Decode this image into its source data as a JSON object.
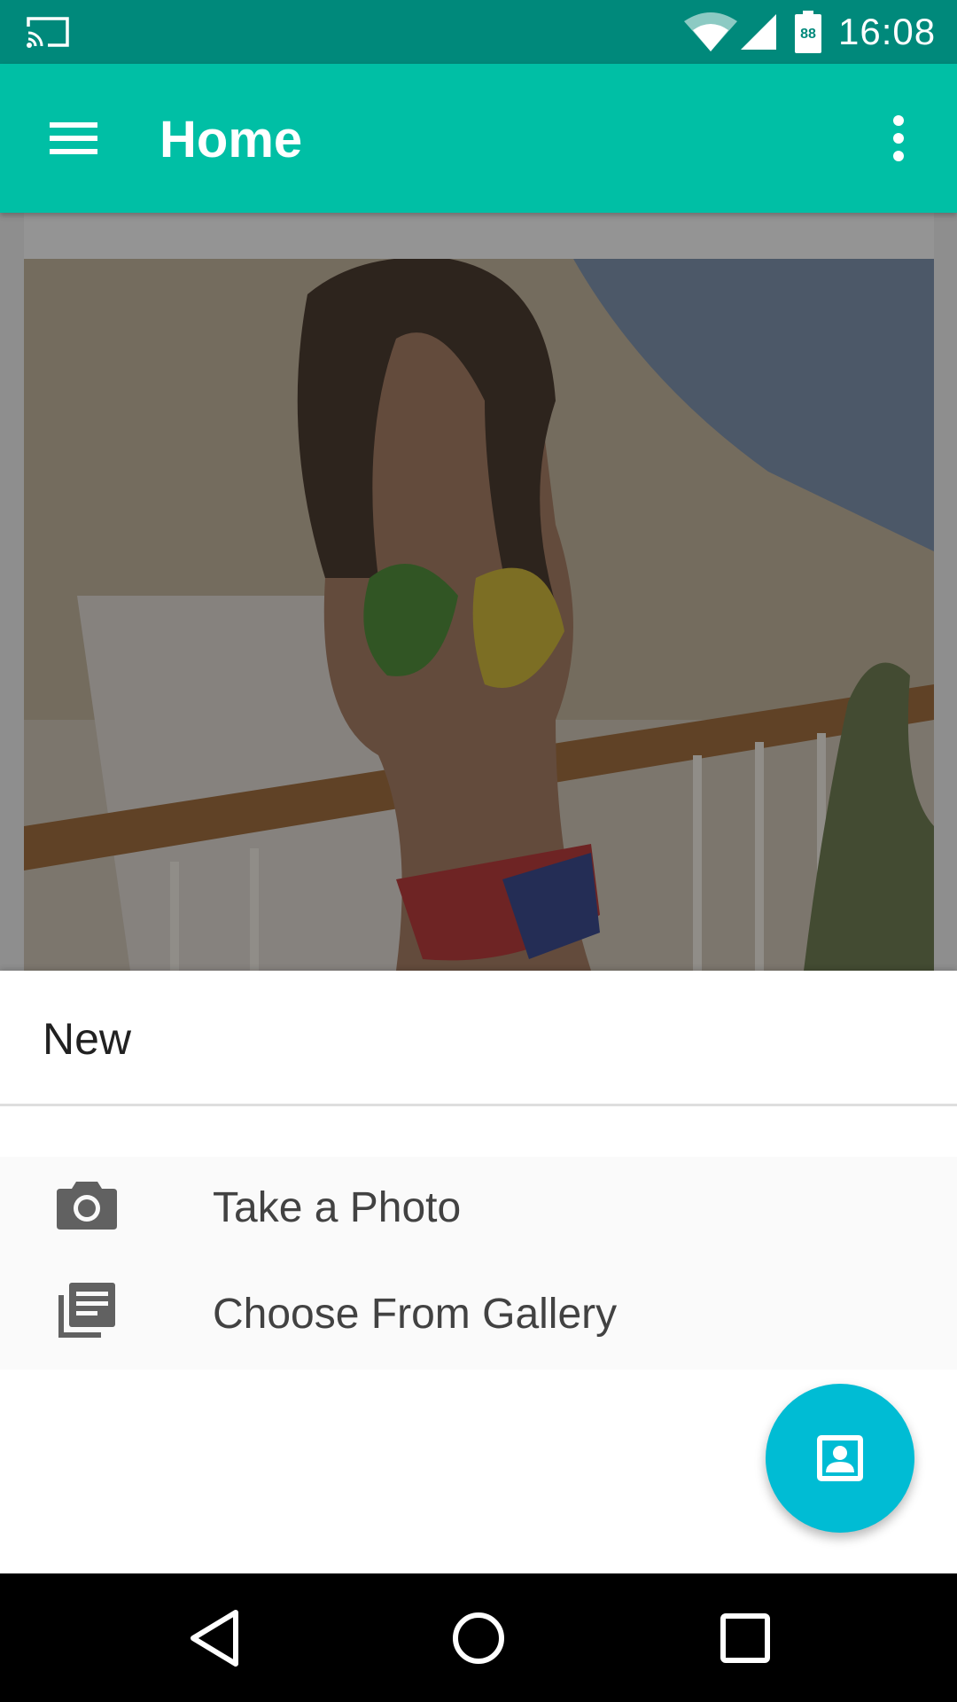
{
  "status_bar": {
    "time": "16:08",
    "battery_level": "88",
    "icons": [
      "cast-icon",
      "wifi-icon",
      "cell-signal-icon",
      "battery-icon"
    ]
  },
  "app_bar": {
    "title": "Home",
    "icons": [
      "hamburger-menu-icon",
      "more-vert-icon"
    ]
  },
  "content": {
    "image": "photo-card"
  },
  "bottom_sheet": {
    "title": "New",
    "items": [
      {
        "label": "Take a Photo",
        "icon": "camera-icon"
      },
      {
        "label": "Choose From Gallery",
        "icon": "gallery-list-icon"
      }
    ]
  },
  "fab": {
    "icon": "portrait-icon"
  },
  "nav_bar": {
    "icons": [
      "back-icon",
      "home-icon",
      "recents-icon"
    ]
  },
  "colors": {
    "status_bar": "#00897B",
    "app_bar": "#00BFA5",
    "fab": "#00BCD4",
    "sheet_background": "#FFFFFF",
    "nav_bar": "#000000"
  }
}
